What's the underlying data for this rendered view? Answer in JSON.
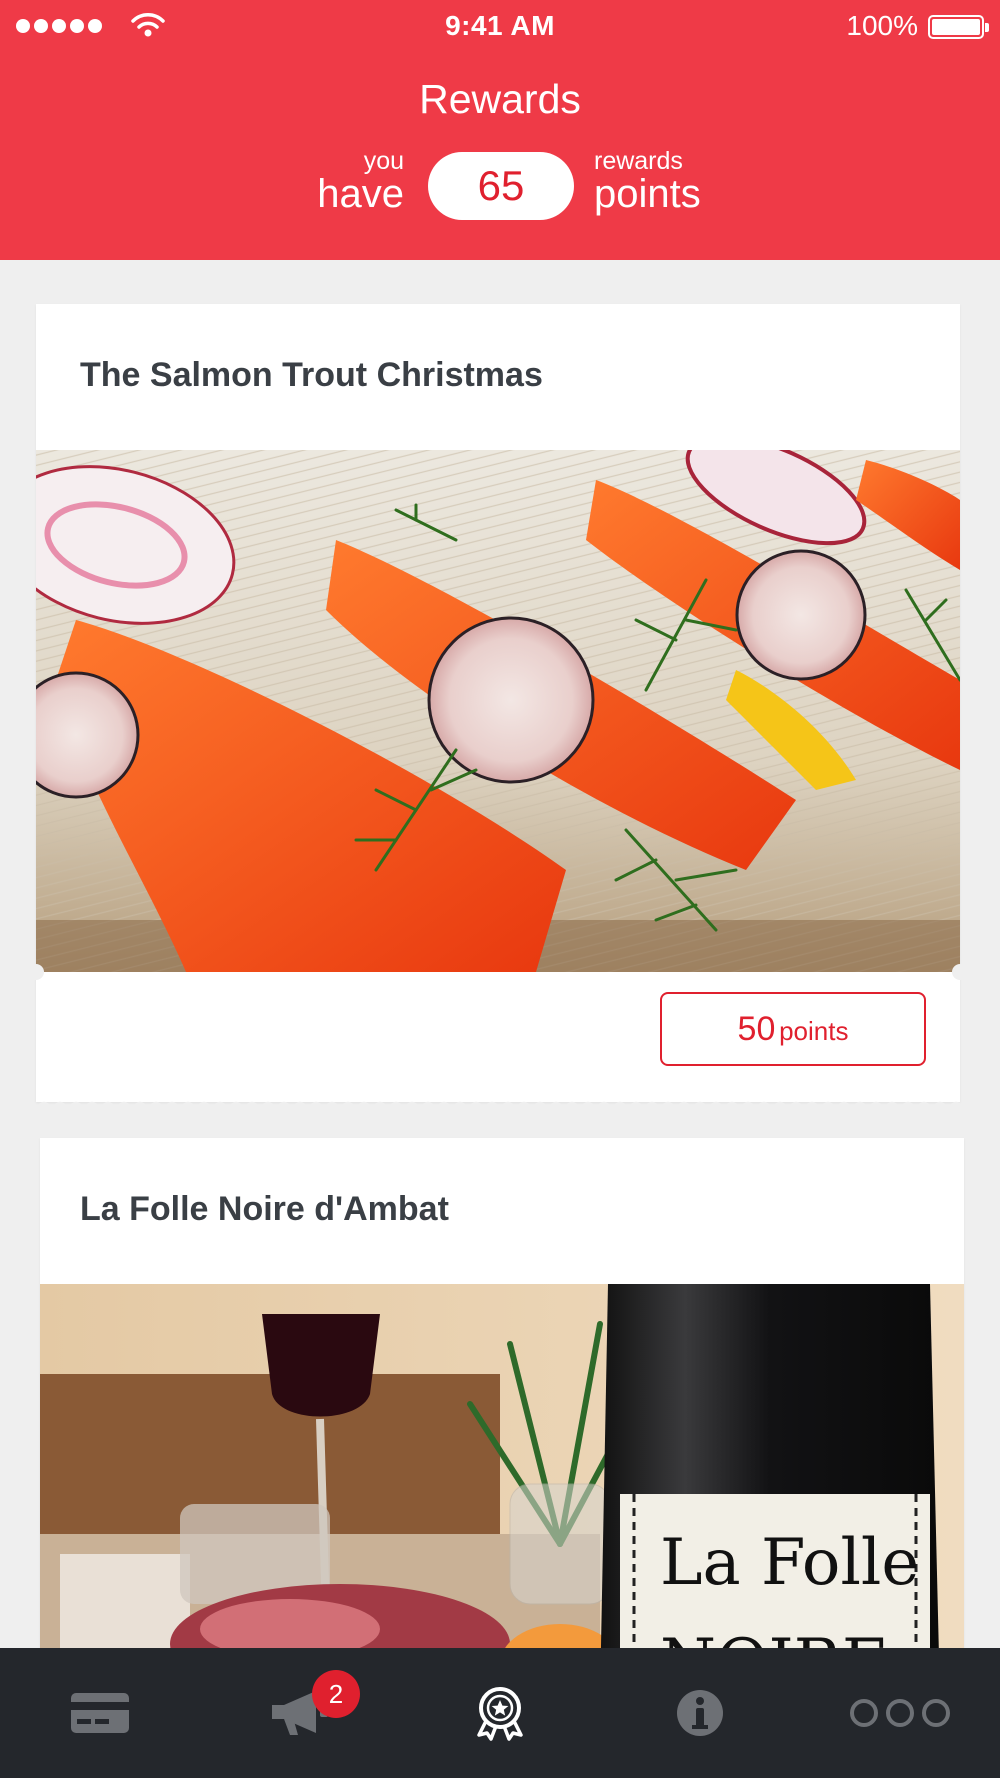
{
  "status_bar": {
    "time": "9:41 AM",
    "battery_percent": "100%",
    "signal_icon": "signal-dots-icon",
    "wifi_icon": "wifi-icon",
    "battery_icon": "battery-icon"
  },
  "header": {
    "title": "Rewards",
    "you": "you",
    "have": "have",
    "points_balance": "65",
    "rewards": "rewards",
    "points": "points",
    "background_color": "#ef3a47"
  },
  "rewards": [
    {
      "title": "The Salmon Trout Christmas",
      "image_subject": "salmon trout slices with radish and dill on wooden board",
      "cost_value": "50",
      "cost_unit": "points"
    },
    {
      "title": "La Folle Noire d'Ambat",
      "image_subject": "bottle of La Folle Noire wine with glass and charcuterie",
      "label_text_1": "La Folle",
      "label_text_2": "NOIRE"
    }
  ],
  "tab_bar": {
    "tabs": [
      {
        "icon": "card-icon",
        "active": false
      },
      {
        "icon": "megaphone-icon",
        "active": false,
        "badge": "2"
      },
      {
        "icon": "award-icon",
        "active": true
      },
      {
        "icon": "info-icon",
        "active": false
      },
      {
        "icon": "more-icon",
        "active": false
      }
    ],
    "background_color": "#24272c",
    "accent_color": "#e0202e"
  }
}
